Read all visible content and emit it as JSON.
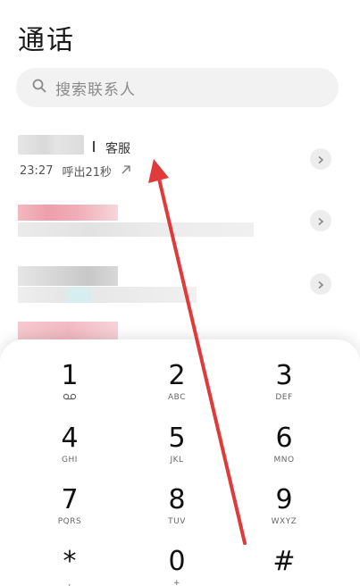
{
  "header": {
    "title": "通话"
  },
  "search": {
    "placeholder": "搜索联系人",
    "icon": "search-icon"
  },
  "recent_calls": [
    {
      "tag": "客服",
      "time": "23:27",
      "detail": "呼出21秒",
      "direction_icon": "outgoing-arrow-icon"
    }
  ],
  "dialpad": {
    "keys": [
      {
        "digit": "1",
        "letters": "",
        "icon": "voicemail-icon"
      },
      {
        "digit": "2",
        "letters": "ABC"
      },
      {
        "digit": "3",
        "letters": "DEF"
      },
      {
        "digit": "4",
        "letters": "GHI"
      },
      {
        "digit": "5",
        "letters": "JKL"
      },
      {
        "digit": "6",
        "letters": "MNO"
      },
      {
        "digit": "7",
        "letters": "PQRS"
      },
      {
        "digit": "8",
        "letters": "TUV"
      },
      {
        "digit": "9",
        "letters": "WXYZ"
      },
      {
        "digit": "*",
        "letters": ","
      },
      {
        "digit": "0",
        "letters": "+"
      },
      {
        "digit": "#",
        "letters": ""
      }
    ]
  },
  "colors": {
    "annotation_arrow": "#e03a3a",
    "search_bg": "#f2f2f2"
  }
}
